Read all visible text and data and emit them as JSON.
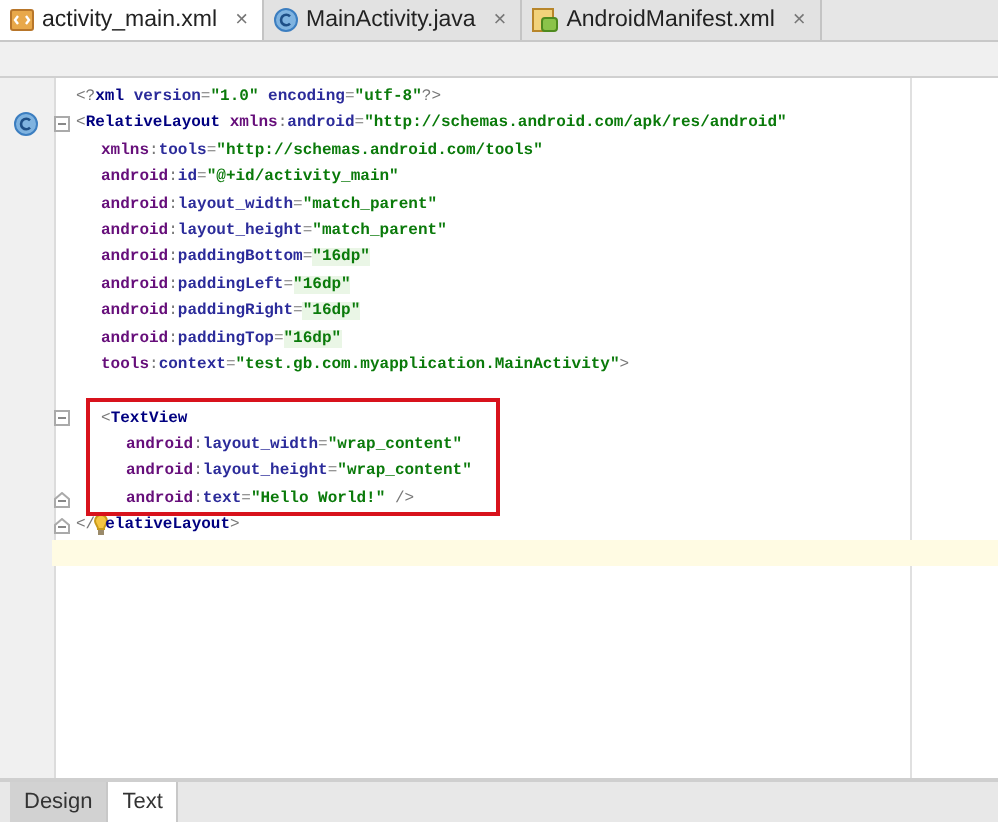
{
  "tabs": [
    {
      "label": "activity_main.xml",
      "kind": "xml",
      "close": "×",
      "selected": true
    },
    {
      "label": "MainActivity.java",
      "kind": "class",
      "close": "×",
      "selected": false
    },
    {
      "label": "AndroidManifest.xml",
      "kind": "manifest",
      "close": "×",
      "selected": false
    }
  ],
  "editor": {
    "lines": [
      {
        "kind": "code",
        "segments": [
          {
            "kind": "punct",
            "text": "<?"
          },
          {
            "kind": "tag",
            "text": "xml"
          },
          {
            "kind": "attr",
            "text": " version"
          },
          {
            "kind": "punct",
            "text": "="
          },
          {
            "kind": "value",
            "text": "\"1.0\""
          },
          {
            "kind": "attr",
            "text": " encoding"
          },
          {
            "kind": "punct",
            "text": "="
          },
          {
            "kind": "value",
            "text": "\"utf-8\""
          },
          {
            "kind": "punct",
            "text": "?>"
          }
        ]
      },
      {
        "kind": "code",
        "class_marker": true,
        "fold_start": true,
        "segments": [
          {
            "kind": "punct",
            "text": "<"
          },
          {
            "kind": "tag",
            "text": "RelativeLayout"
          },
          {
            "kind": "ns",
            "text": " xmlns"
          },
          {
            "kind": "punct",
            "text": ":"
          },
          {
            "kind": "attr",
            "text": "android"
          },
          {
            "kind": "punct",
            "text": "="
          },
          {
            "kind": "value",
            "text": "\"http://schemas.android.com/apk/res/android\""
          }
        ],
        "children": [
          {
            "kind": "code",
            "segments": [
              {
                "kind": "ns",
                "text": "xmlns"
              },
              {
                "kind": "punct",
                "text": ":"
              },
              {
                "kind": "attr",
                "text": "tools"
              },
              {
                "kind": "punct",
                "text": "="
              },
              {
                "kind": "value",
                "text": "\"http://schemas.android.com/tools\""
              }
            ]
          },
          {
            "kind": "code",
            "segments": [
              {
                "kind": "ns",
                "text": "android"
              },
              {
                "kind": "punct",
                "text": ":"
              },
              {
                "kind": "attr",
                "text": "id"
              },
              {
                "kind": "punct",
                "text": "="
              },
              {
                "kind": "value",
                "text": "\"@+id/activity_main\""
              }
            ]
          },
          {
            "kind": "code",
            "segments": [
              {
                "kind": "ns",
                "text": "android"
              },
              {
                "kind": "punct",
                "text": ":"
              },
              {
                "kind": "attr",
                "text": "layout_width"
              },
              {
                "kind": "punct",
                "text": "="
              },
              {
                "kind": "value",
                "text": "\"match_parent\""
              }
            ]
          },
          {
            "kind": "code",
            "segments": [
              {
                "kind": "ns",
                "text": "android"
              },
              {
                "kind": "punct",
                "text": ":"
              },
              {
                "kind": "attr",
                "text": "layout_height"
              },
              {
                "kind": "punct",
                "text": "="
              },
              {
                "kind": "value",
                "text": "\"match_parent\""
              }
            ]
          },
          {
            "kind": "code",
            "segments": [
              {
                "kind": "ns",
                "text": "android"
              },
              {
                "kind": "punct",
                "text": ":"
              },
              {
                "kind": "attr",
                "text": "paddingBottom"
              },
              {
                "kind": "punct",
                "text": "="
              },
              {
                "kind": "value-dim",
                "text": "\"16dp\""
              }
            ]
          },
          {
            "kind": "code",
            "segments": [
              {
                "kind": "ns",
                "text": "android"
              },
              {
                "kind": "punct",
                "text": ":"
              },
              {
                "kind": "attr",
                "text": "paddingLeft"
              },
              {
                "kind": "punct",
                "text": "="
              },
              {
                "kind": "value-dim",
                "text": "\"16dp\""
              }
            ]
          },
          {
            "kind": "code",
            "segments": [
              {
                "kind": "ns",
                "text": "android"
              },
              {
                "kind": "punct",
                "text": ":"
              },
              {
                "kind": "attr",
                "text": "paddingRight"
              },
              {
                "kind": "punct",
                "text": "="
              },
              {
                "kind": "value-dim",
                "text": "\"16dp\""
              }
            ]
          },
          {
            "kind": "code",
            "segments": [
              {
                "kind": "ns",
                "text": "android"
              },
              {
                "kind": "punct",
                "text": ":"
              },
              {
                "kind": "attr",
                "text": "paddingTop"
              },
              {
                "kind": "punct",
                "text": "="
              },
              {
                "kind": "value-dim",
                "text": "\"16dp\""
              }
            ]
          },
          {
            "kind": "code",
            "segments": [
              {
                "kind": "ns",
                "text": "tools"
              },
              {
                "kind": "punct",
                "text": ":"
              },
              {
                "kind": "attr",
                "text": "context"
              },
              {
                "kind": "punct",
                "text": "="
              },
              {
                "kind": "value",
                "text": "\"test.gb.com.myapplication.MainActivity\""
              },
              {
                "kind": "punct",
                "text": ">"
              }
            ]
          },
          {
            "kind": "blank"
          },
          {
            "kind": "code",
            "fold_start": true,
            "highlighted": true,
            "segments": [
              {
                "kind": "punct",
                "text": "<"
              },
              {
                "kind": "tag",
                "text": "TextView"
              }
            ],
            "children": [
              {
                "kind": "code",
                "segments": [
                  {
                    "kind": "ns",
                    "text": "android"
                  },
                  {
                    "kind": "punct",
                    "text": ":"
                  },
                  {
                    "kind": "attr",
                    "text": "layout_width"
                  },
                  {
                    "kind": "punct",
                    "text": "="
                  },
                  {
                    "kind": "value",
                    "text": "\"wrap_content\""
                  }
                ]
              },
              {
                "kind": "code",
                "segments": [
                  {
                    "kind": "ns",
                    "text": "android"
                  },
                  {
                    "kind": "punct",
                    "text": ":"
                  },
                  {
                    "kind": "attr",
                    "text": "layout_height"
                  },
                  {
                    "kind": "punct",
                    "text": "="
                  },
                  {
                    "kind": "value",
                    "text": "\"wrap_content\""
                  }
                ]
              },
              {
                "kind": "code",
                "fold_end": true,
                "segments": [
                  {
                    "kind": "ns",
                    "text": "android"
                  },
                  {
                    "kind": "punct",
                    "text": ":"
                  },
                  {
                    "kind": "attr",
                    "text": "text"
                  },
                  {
                    "kind": "punct",
                    "text": "="
                  },
                  {
                    "kind": "value",
                    "text": "\"Hello World!\""
                  },
                  {
                    "kind": "punct",
                    "text": " />"
                  }
                ]
              }
            ]
          }
        ]
      },
      {
        "kind": "code",
        "fold_end": true,
        "bulb": true,
        "segments": [
          {
            "kind": "punct",
            "text": "</"
          },
          {
            "kind": "tag",
            "text": "elativeLayout"
          },
          {
            "kind": "punct",
            "text": ">"
          }
        ]
      },
      {
        "kind": "blank",
        "current": true
      }
    ]
  },
  "bottom_tabs": [
    {
      "label": "Design",
      "selected": false
    },
    {
      "label": "Text",
      "selected": true
    }
  ]
}
